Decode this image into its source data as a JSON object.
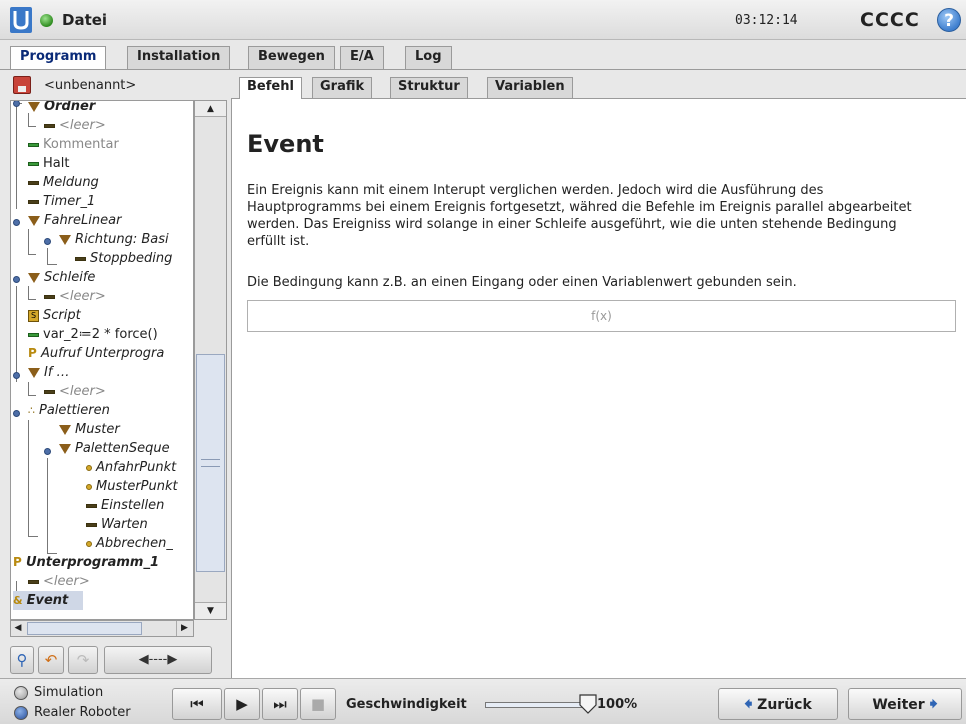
{
  "header": {
    "file_label": "Datei",
    "clock": "03:12:14",
    "robot_name": "CCCC",
    "help_label": "?"
  },
  "main_tabs": [
    "Programm",
    "Installation",
    "Bewegen",
    "E/A",
    "Log"
  ],
  "program": {
    "name": "<unbenannt>"
  },
  "tree": [
    {
      "label": "Ordner",
      "icon": "folder-triangle-icon"
    },
    {
      "label": "<leer>",
      "icon": "empty-bar-icon"
    },
    {
      "label": "Kommentar",
      "icon": "green-bar-icon"
    },
    {
      "label": "Halt",
      "icon": "green-bar-icon"
    },
    {
      "label": "Meldung",
      "icon": "bar-icon"
    },
    {
      "label": "Timer_1",
      "icon": "bar-icon"
    },
    {
      "label": "FahreLinear",
      "icon": "triangle-icon"
    },
    {
      "label": "Richtung: Basi",
      "icon": "triangle-icon"
    },
    {
      "label": "Stoppbeding",
      "icon": "bar-icon"
    },
    {
      "label": "Schleife",
      "icon": "triangle-icon"
    },
    {
      "label": "<leer>",
      "icon": "empty-bar-icon"
    },
    {
      "label": "Script",
      "icon": "script-icon"
    },
    {
      "label": "var_2≔2 * force()",
      "icon": "green-bar-icon"
    },
    {
      "label": "Aufruf Unterprogra",
      "icon": "subprogram-icon"
    },
    {
      "label": "If …",
      "icon": "triangle-icon"
    },
    {
      "label": "<leer>",
      "icon": "empty-bar-icon"
    },
    {
      "label": "Palettieren",
      "icon": "pallet-icon"
    },
    {
      "label": "Muster",
      "icon": "triangle-icon"
    },
    {
      "label": "PalettenSeque",
      "icon": "triangle-icon"
    },
    {
      "label": "AnfahrPunkt",
      "icon": "waypoint-icon"
    },
    {
      "label": "MusterPunkt",
      "icon": "waypoint-icon"
    },
    {
      "label": "Einstellen",
      "icon": "bar-icon"
    },
    {
      "label": "Warten",
      "icon": "bar-icon"
    },
    {
      "label": "Abbrechen_",
      "icon": "waypoint-icon"
    },
    {
      "label": "Unterprogramm_1",
      "icon": "subprogram-icon"
    },
    {
      "label": "<leer>",
      "icon": "empty-bar-icon"
    },
    {
      "label": "Event",
      "icon": "event-icon"
    }
  ],
  "sub_tabs": [
    "Befehl",
    "Grafik",
    "Struktur",
    "Variablen"
  ],
  "command": {
    "title": "Event",
    "description": "Ein Ereignis kann mit einem Interupt verglichen werden. Jedoch wird die Ausführung des Hauptprogramms bei einem Ereignis fortgesetzt, währed die Befehle im Ereignis parallel abgearbeitet werden. Das Ereigniss wird solange in einer Schleife ausgeführt, wie die unten stehende Bedingung erfüllt ist.",
    "hint": "Die Bedingung kann z.B. an einen Eingang oder einen Variablenwert gebunden sein.",
    "expression_placeholder": "f(x)"
  },
  "footer": {
    "simulation_label": "Simulation",
    "real_robot_label": "Realer Roboter",
    "speed_label": "Geschwindigkeit",
    "speed_value": "100%",
    "speed_fraction": 1.0,
    "back_label": "Zurück",
    "next_label": "Weiter"
  },
  "colors": {
    "active_tab_text": "#0a2a78",
    "selection": "#cfd7e6",
    "accent_blue": "#2f65b5"
  }
}
